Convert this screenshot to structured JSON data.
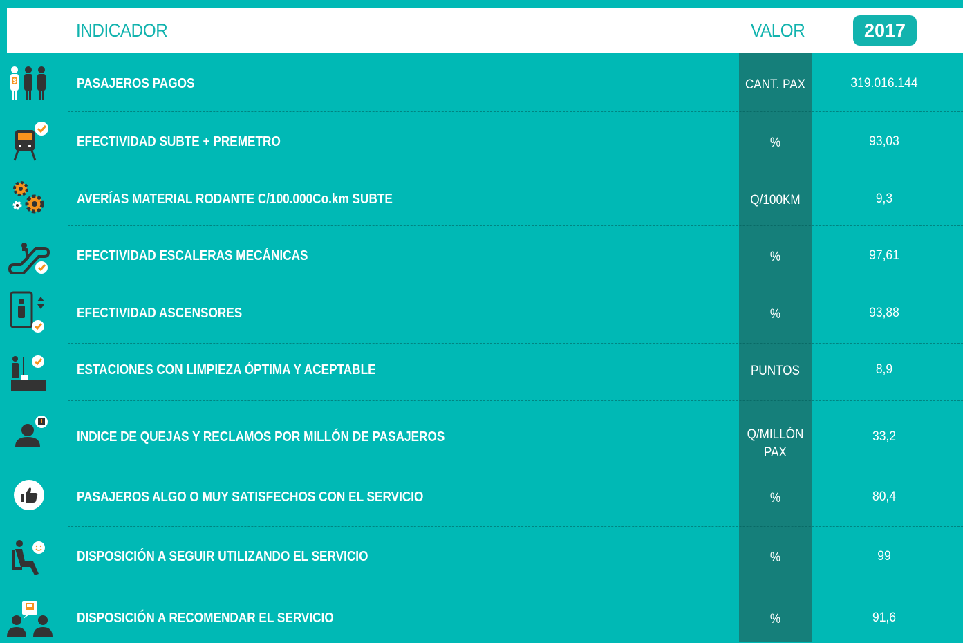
{
  "header": {
    "indicator_label": "INDICADOR",
    "value_label": "VALOR",
    "year": "2017"
  },
  "colors": {
    "background": "#00b9b5",
    "unit_column": "#157f7a",
    "header_text": "#12b3ae",
    "accent_orange": "#f7941d"
  },
  "rows": [
    {
      "icon": "paying-passengers-icon",
      "label": "PASAJEROS PAGOS",
      "unit": "CANT. PAX",
      "value": "319.016.144"
    },
    {
      "icon": "train-check-icon",
      "label": "EFECTIVIDAD SUBTE + PREMETRO",
      "unit": "%",
      "value": "93,03"
    },
    {
      "icon": "gears-icon",
      "label": "AVERÍAS MATERIAL RODANTE C/100.000Co.km SUBTE",
      "unit": "Q/100KM",
      "value": "9,3"
    },
    {
      "icon": "escalator-check-icon",
      "label": "EFECTIVIDAD ESCALERAS MECÁNICAS",
      "unit": "%",
      "value": "97,61"
    },
    {
      "icon": "elevator-check-icon",
      "label": "EFECTIVIDAD ASCENSORES",
      "unit": "%",
      "value": "93,88"
    },
    {
      "icon": "cleaning-check-icon",
      "label": "ESTACIONES CON LIMPIEZA ÓPTIMA Y ACEPTABLE",
      "unit": "PUNTOS",
      "value": "8,9"
    },
    {
      "icon": "complaint-person-icon",
      "label": "INDICE DE QUEJAS Y RECLAMOS POR MILLÓN DE PASAJEROS",
      "unit": "Q/MILLÓN PAX",
      "value": "33,2"
    },
    {
      "icon": "thumbs-up-icon",
      "label": "PASAJEROS ALGO O MUY SATISFECHOS CON EL SERVICIO",
      "unit": "%",
      "value": "80,4"
    },
    {
      "icon": "seated-smile-icon",
      "label": "DISPOSICIÓN A SEGUIR UTILIZANDO EL SERVICIO",
      "unit": "%",
      "value": "99"
    },
    {
      "icon": "recommend-people-icon",
      "label": "DISPOSICIÓN A RECOMENDAR EL SERVICIO",
      "unit": "%",
      "value": "91,6"
    }
  ]
}
